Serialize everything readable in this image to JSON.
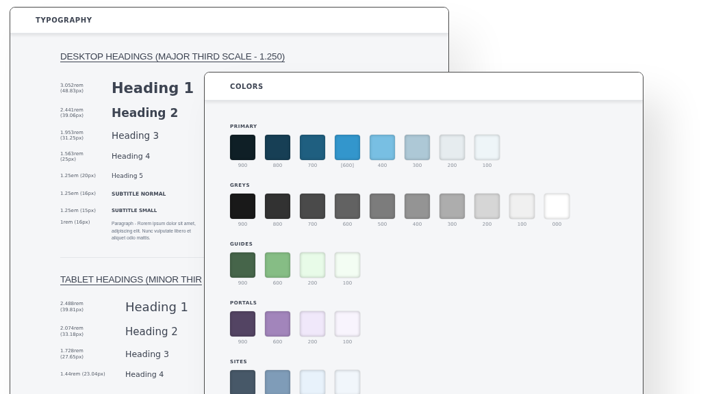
{
  "typography_window": {
    "title": "TYPOGRAPHY",
    "sections": [
      {
        "heading": "DESKTOP HEADINGS (MAJOR THIRD SCALE - 1.250)",
        "kind": "desktop",
        "rows": [
          {
            "size": "3.052rem\n(48.83px)",
            "sample": "Heading 1",
            "kind": "h1"
          },
          {
            "size": "2.441rem\n(39.06px)",
            "sample": "Heading 2",
            "kind": "h2"
          },
          {
            "size": "1.953rem\n(31.25px)",
            "sample": "Heading 3",
            "kind": "h3"
          },
          {
            "size": "1.563rem\n(25px)",
            "sample": "Heading 4",
            "kind": "h4"
          },
          {
            "size": "1.25em (20px)",
            "sample": "Heading 5",
            "kind": "h5"
          },
          {
            "size": "1.25em (16px)",
            "sample": "SUBTITLE NORMAL",
            "kind": "subtitle"
          },
          {
            "size": "1.25em (15px)",
            "sample": "SUBTITLE SMALL",
            "kind": "subtitle-small"
          },
          {
            "size": "1rem (16px)",
            "sample": "Paragraph - Rorem ipsum dolor sit amet,\nadipiscing elit. Nunc vulputate libero et\naliquet odio mattis.",
            "kind": "paragraph"
          }
        ]
      },
      {
        "heading": "TABLET HEADINGS (MINOR THIR",
        "kind": "tablet",
        "rows": [
          {
            "size": "2.488rem\n(39.81px)",
            "sample": "Heading 1",
            "kind": "h1"
          },
          {
            "size": "2.074rem\n(33.18px)",
            "sample": "Heading 2",
            "kind": "h2"
          },
          {
            "size": "1.728rem\n(27.65px)",
            "sample": "Heading 3",
            "kind": "h3"
          },
          {
            "size": "1.44rem (23.04px)",
            "sample": "Heading 4",
            "kind": "h4"
          }
        ]
      }
    ]
  },
  "colors_window": {
    "title": "COLORS",
    "groups": [
      {
        "name": "PRIMARY",
        "swatches": [
          {
            "label": "900",
            "color": "#0f1f26"
          },
          {
            "label": "800",
            "color": "#173f55"
          },
          {
            "label": "700",
            "color": "#1f5f80"
          },
          {
            "label": "[600]",
            "color": "#3396cc"
          },
          {
            "label": "400",
            "color": "#78bfe3"
          },
          {
            "label": "300",
            "color": "#adc8d6"
          },
          {
            "label": "200",
            "color": "#e6ecef"
          },
          {
            "label": "100",
            "color": "#eef5f8"
          }
        ]
      },
      {
        "name": "GREYS",
        "swatches": [
          {
            "label": "900",
            "color": "#191919"
          },
          {
            "label": "800",
            "color": "#323232"
          },
          {
            "label": "700",
            "color": "#4a4a4a"
          },
          {
            "label": "600",
            "color": "#626262"
          },
          {
            "label": "500",
            "color": "#7c7c7c"
          },
          {
            "label": "400",
            "color": "#949494"
          },
          {
            "label": "300",
            "color": "#adadad"
          },
          {
            "label": "200",
            "color": "#d6d6d6"
          },
          {
            "label": "100",
            "color": "#f0f0f0"
          },
          {
            "label": "000",
            "color": "#ffffff"
          }
        ]
      },
      {
        "name": "GUIDES",
        "swatches": [
          {
            "label": "900",
            "color": "#46654a"
          },
          {
            "label": "600",
            "color": "#86bd85"
          },
          {
            "label": "200",
            "color": "#e8fbe8"
          },
          {
            "label": "100",
            "color": "#f3fdf3"
          }
        ]
      },
      {
        "name": "PORTALS",
        "swatches": [
          {
            "label": "900",
            "color": "#534463"
          },
          {
            "label": "600",
            "color": "#a285bb"
          },
          {
            "label": "200",
            "color": "#f0e8fa"
          },
          {
            "label": "100",
            "color": "#f8f4fd"
          }
        ]
      },
      {
        "name": "SITES",
        "swatches": [
          {
            "color": "#475868"
          },
          {
            "color": "#7f9cb8"
          },
          {
            "color": "#e8f2fb"
          },
          {
            "color": "#f1f6fb"
          }
        ]
      }
    ]
  }
}
